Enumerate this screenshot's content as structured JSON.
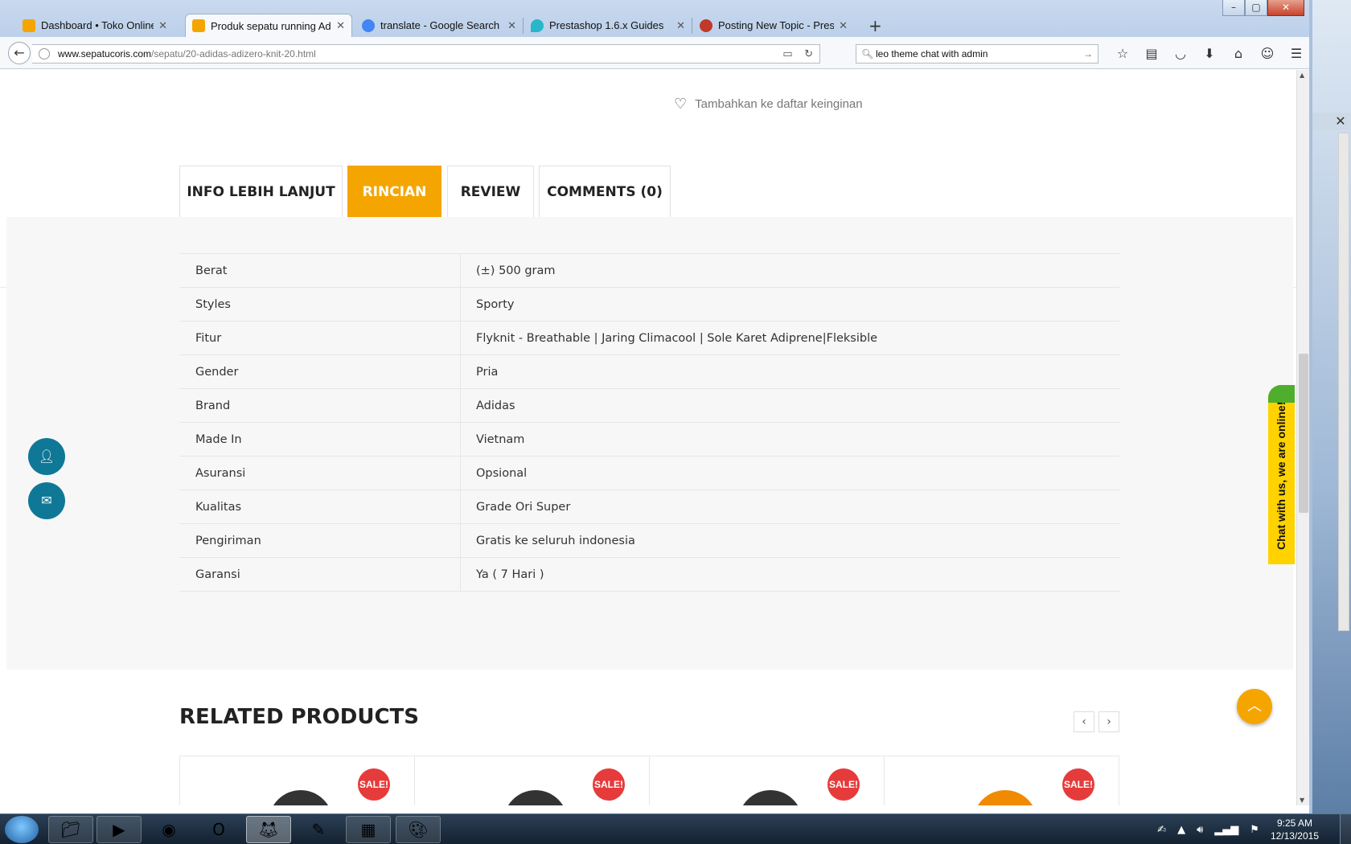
{
  "browser": {
    "tabs": [
      {
        "label": "Dashboard • Toko Online S...",
        "active": false,
        "favicon_color": "#f5a500"
      },
      {
        "label": "Produk sepatu running Adi...",
        "active": true,
        "favicon_color": "#f5a500"
      },
      {
        "label": "translate - Google Search",
        "active": false,
        "favicon_color": "#4285f4"
      },
      {
        "label": "Prestashop 1.6.x Guides",
        "active": false,
        "favicon_color": "#29b6c8"
      },
      {
        "label": "Posting New Topic - Presta...",
        "active": false,
        "favicon_color": "#c0392b"
      }
    ],
    "url_host": "www.sepatucoris.com",
    "url_path": "/sepatu/20-adidas-adizero-knit-20.html",
    "search_value": "leo theme chat with admin"
  },
  "page": {
    "wishlist_label": "Tambahkan ke daftar keinginan",
    "product_tabs": [
      {
        "label": "INFO LEBIH LANJUT",
        "active": false
      },
      {
        "label": "RINCIAN",
        "active": true
      },
      {
        "label": "REVIEW",
        "active": false
      },
      {
        "label": "COMMENTS (0)",
        "active": false
      }
    ],
    "specs": [
      {
        "key": "Berat",
        "value": "(±) 500 gram"
      },
      {
        "key": "Styles",
        "value": "Sporty"
      },
      {
        "key": "Fitur",
        "value": "Flyknit - Breathable | Jaring Climacool | Sole Karet Adiprene|Fleksible"
      },
      {
        "key": "Gender",
        "value": "Pria"
      },
      {
        "key": "Brand",
        "value": "Adidas"
      },
      {
        "key": "Made In",
        "value": "Vietnam"
      },
      {
        "key": "Asuransi",
        "value": "Opsional"
      },
      {
        "key": "Kualitas",
        "value": "Grade Ori Super"
      },
      {
        "key": "Pengiriman",
        "value": "Gratis ke seluruh indonesia"
      },
      {
        "key": "Garansi",
        "value": "Ya ( 7 Hari )"
      }
    ],
    "chat_label": "Chat with us, we are online!",
    "related_title": "RELATED PRODUCTS",
    "carousel_prev": "‹",
    "carousel_next": "›",
    "sale_badges": [
      "SALE!",
      "SALE!",
      "SALE!",
      "SALE!"
    ],
    "accent_color": "#f5a500"
  },
  "taskbar": {
    "time": "9:25 AM",
    "date": "12/13/2015"
  }
}
